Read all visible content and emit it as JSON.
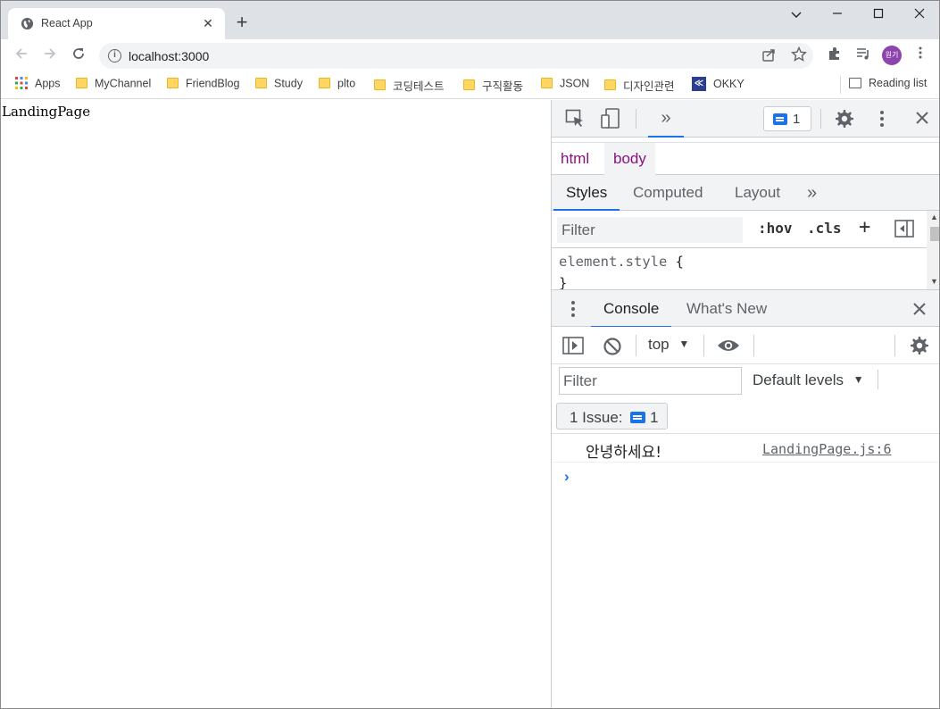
{
  "browser": {
    "tab_title": "React App",
    "url": "localhost:3000",
    "avatar_text": "원기",
    "bookmarks": [
      {
        "label": "Apps",
        "type": "apps"
      },
      {
        "label": "MyChannel",
        "type": "folder"
      },
      {
        "label": "FriendBlog",
        "type": "folder"
      },
      {
        "label": "Study",
        "type": "folder"
      },
      {
        "label": "plto",
        "type": "folder"
      },
      {
        "label": "코딩테스트",
        "type": "folder"
      },
      {
        "label": "구직활동",
        "type": "folder"
      },
      {
        "label": "JSON",
        "type": "folder"
      },
      {
        "label": "디자인관련",
        "type": "folder"
      },
      {
        "label": "OKKY",
        "type": "site"
      }
    ],
    "reading_list": "Reading list"
  },
  "page": {
    "text": "LandingPage"
  },
  "devtools": {
    "issues_count": "1",
    "breadcrumbs": [
      "html",
      "body"
    ],
    "style_tabs": [
      "Styles",
      "Computed",
      "Layout"
    ],
    "styles_filter_placeholder": "Filter",
    "hov": ":hov",
    "cls": ".cls",
    "element_style": "element.style",
    "drawer_tabs": [
      "Console",
      "What's New"
    ],
    "context": "top",
    "console_filter_placeholder": "Filter",
    "levels": "Default levels",
    "issues_label": "1 Issue:",
    "issues_pill_count": "1",
    "log": {
      "message": "안녕하세요!",
      "source": "LandingPage.js:6"
    }
  },
  "colors": {
    "accent": "#1a73e8",
    "tag": "#881280",
    "avatar": "#8e44ad"
  }
}
